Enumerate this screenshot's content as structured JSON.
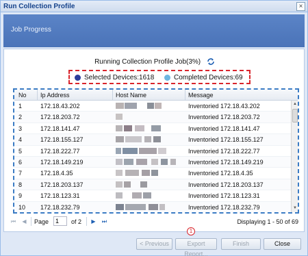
{
  "window": {
    "title": "Run Collection Profile",
    "close_glyph": "×"
  },
  "banner": {
    "text": "Job Progress"
  },
  "job": {
    "title": "Running Collection Profile Job(3%)",
    "refresh_icon": "refresh-icon"
  },
  "legend": {
    "selected_label": "Selected Devices:1618",
    "completed_label": "Completed Devices:69",
    "selected_color": "#2b3e9b",
    "completed_color": "#6fb7e0"
  },
  "grid": {
    "columns": [
      "No",
      "Ip Address",
      "Host Name",
      "Message"
    ],
    "rows": [
      {
        "no": "1",
        "ip": "172.18.43.202",
        "message": "Inventoried 172.18.43.202"
      },
      {
        "no": "2",
        "ip": "172.18.203.72",
        "message": "Inventoried 172.18.203.72"
      },
      {
        "no": "3",
        "ip": "172.18.141.47",
        "message": "Inventoried 172.18.141.47"
      },
      {
        "no": "4",
        "ip": "172.18.155.127",
        "message": "Inventoried 172.18.155.127"
      },
      {
        "no": "5",
        "ip": "172.18.222.77",
        "message": "Inventoried 172.18.222.77"
      },
      {
        "no": "6",
        "ip": "172.18.149.219",
        "message": "Inventoried 172.18.149.219"
      },
      {
        "no": "7",
        "ip": "172.18.4.35",
        "message": "Inventoried 172.18.4.35"
      },
      {
        "no": "8",
        "ip": "172.18.203.137",
        "message": "Inventoried 172.18.203.137"
      },
      {
        "no": "9",
        "ip": "172.18.123.31",
        "message": "Inventoried 172.18.123.31"
      },
      {
        "no": "10",
        "ip": "172.18.232.79",
        "message": "Inventoried 172.18.232.79"
      }
    ]
  },
  "pager": {
    "page_label": "Page",
    "page_value": "1",
    "of_label": "of 2",
    "display_text": "Displaying 1 - 50 of 69"
  },
  "marker": {
    "text": "1"
  },
  "footer": {
    "previous_label": "< Previous",
    "export_label": "Export Report...",
    "finish_label": "Finish",
    "close_label": "Close"
  }
}
